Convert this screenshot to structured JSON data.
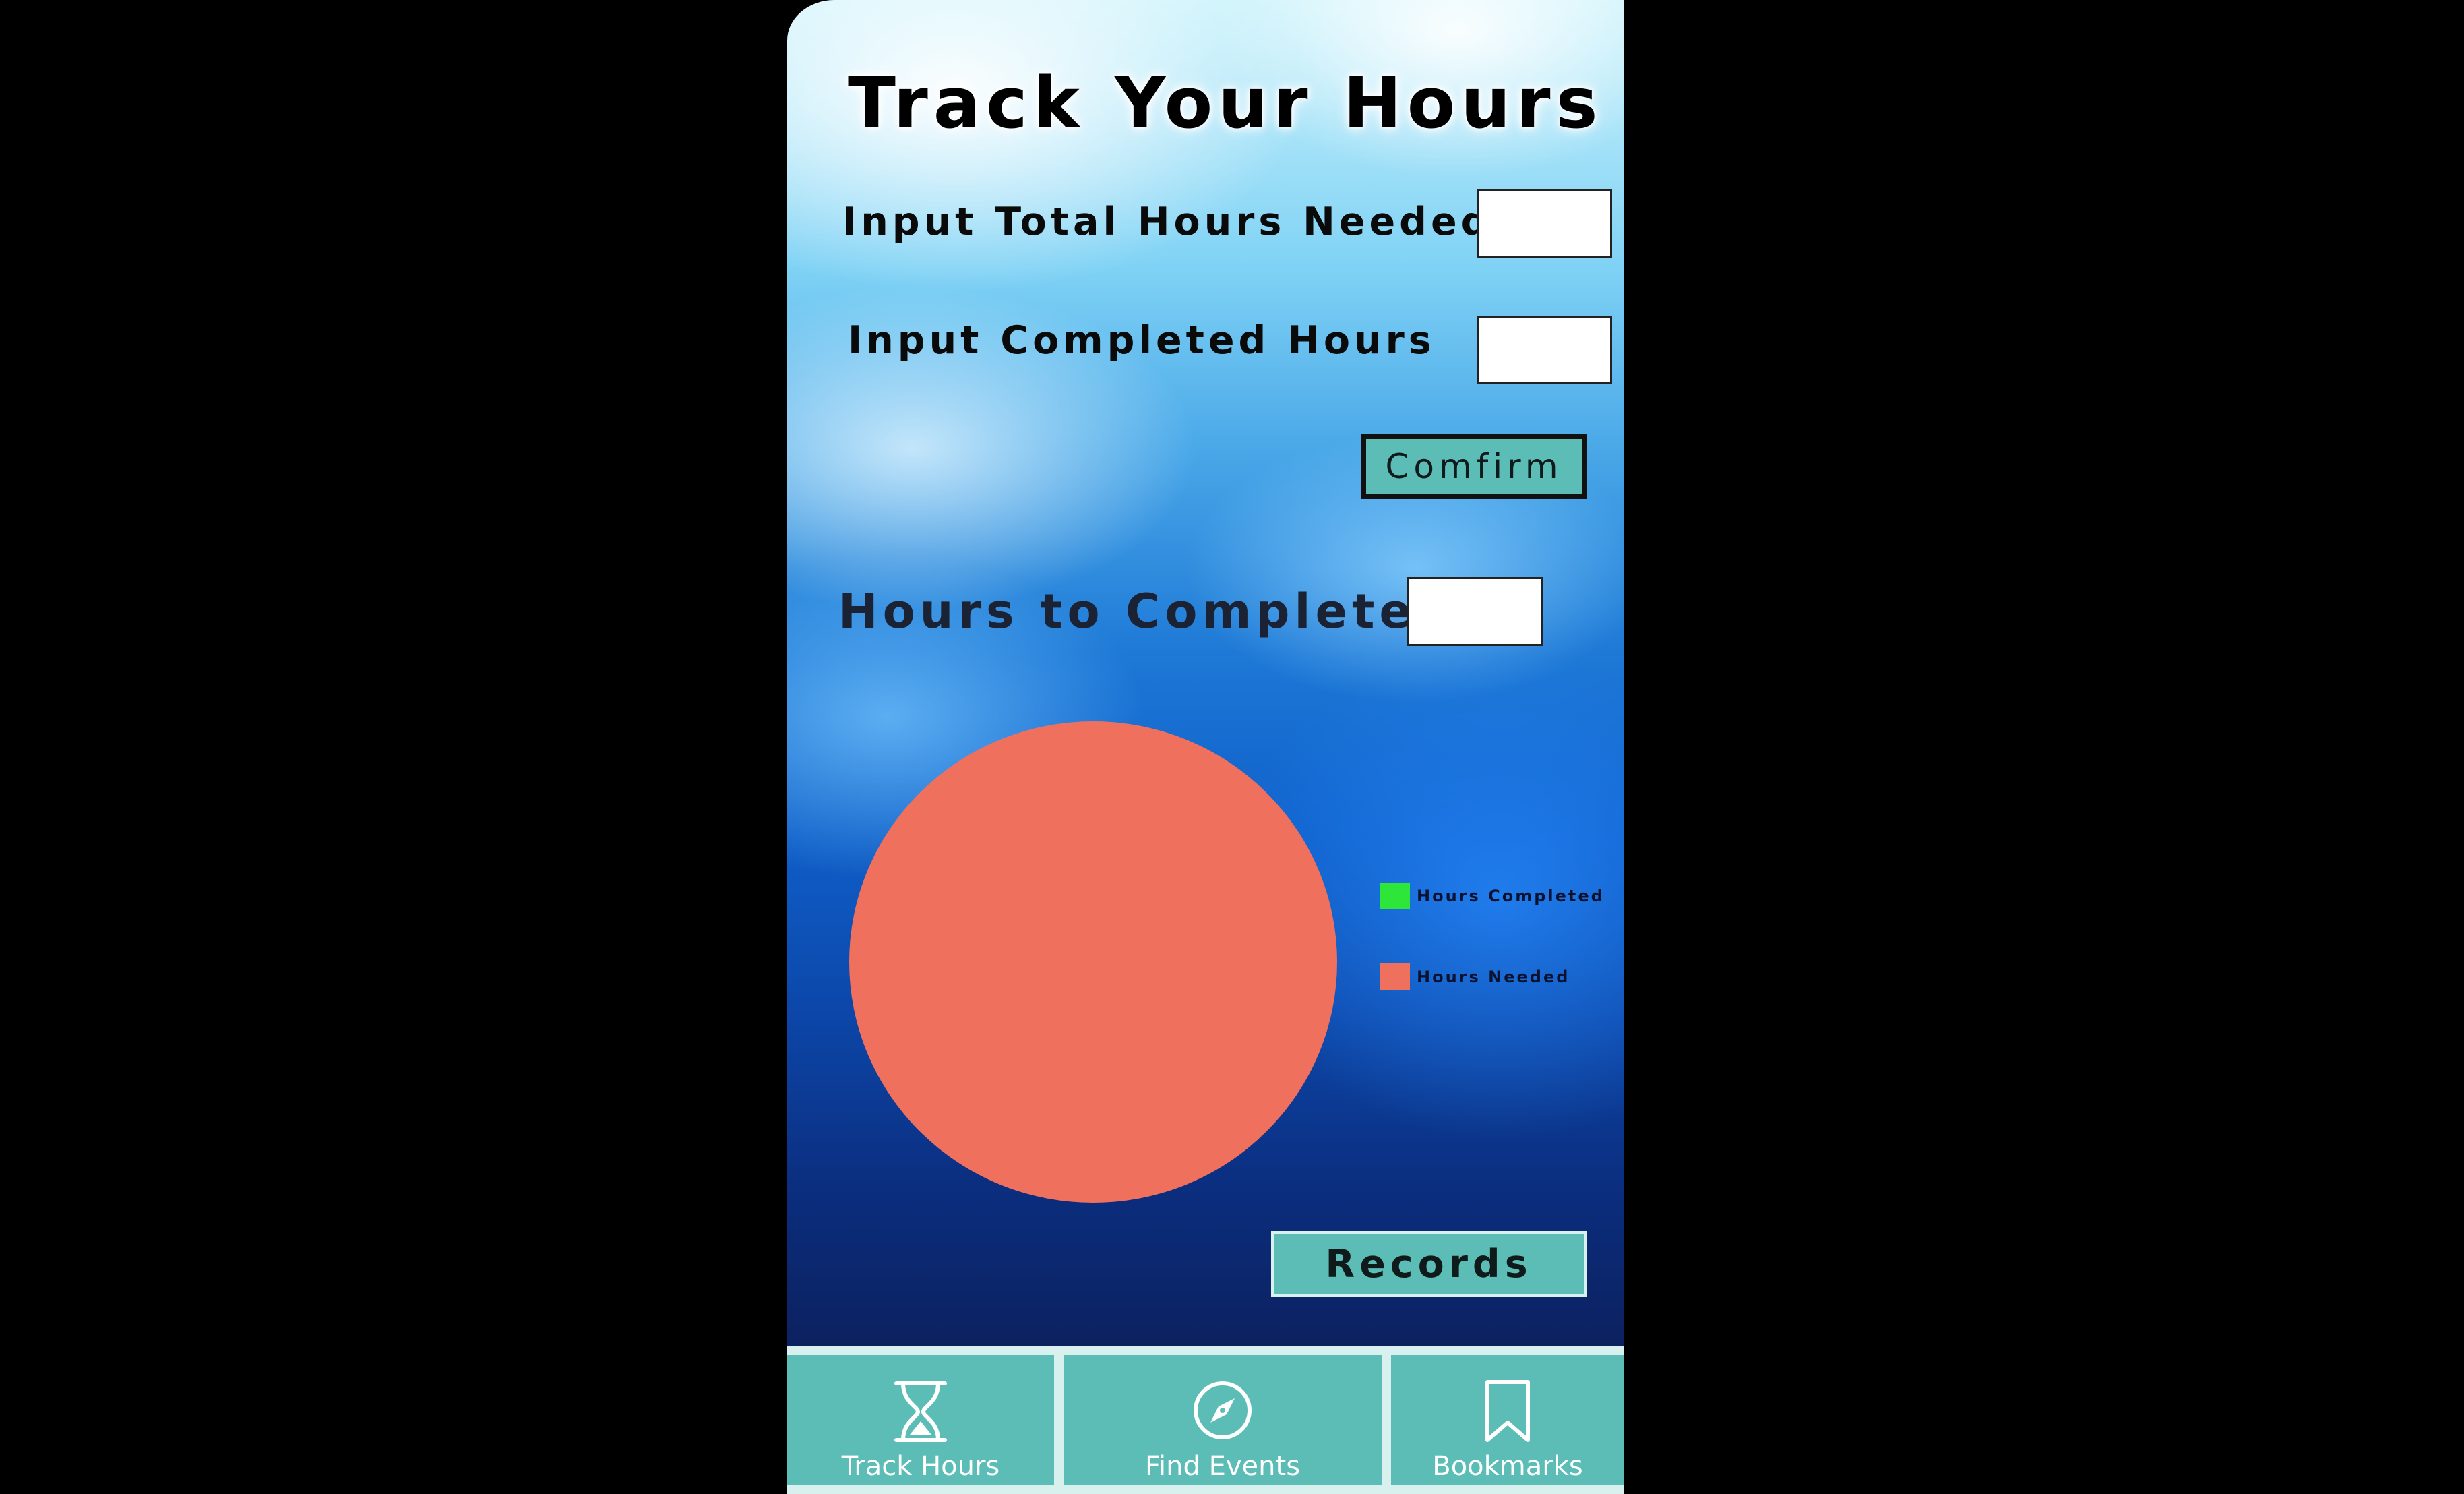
{
  "header": {
    "title": "Track Your Hours"
  },
  "form": {
    "total_hours_label": "Input Total Hours Needed",
    "total_hours_value": "",
    "completed_hours_label": "Input Completed Hours",
    "completed_hours_value": "",
    "confirm_label": "Comfirm",
    "remaining_label": "Hours to Complete",
    "remaining_value": ""
  },
  "chart_data": {
    "type": "pie",
    "series": [
      {
        "name": "Hours Completed",
        "value": 0,
        "color": "#2ee53a"
      },
      {
        "name": "Hours Needed",
        "value": 1,
        "color": "#f0705e"
      }
    ]
  },
  "records_label": "Records",
  "tabbar": {
    "items": [
      {
        "label": "Track Hours",
        "icon": "hourglass-icon"
      },
      {
        "label": "Find Events",
        "icon": "compass-icon"
      },
      {
        "label": "Bookmarks",
        "icon": "bookmark-icon"
      }
    ]
  },
  "colors": {
    "accent": "#5cbdb6",
    "completed": "#2ee53a",
    "needed": "#f0705e"
  }
}
